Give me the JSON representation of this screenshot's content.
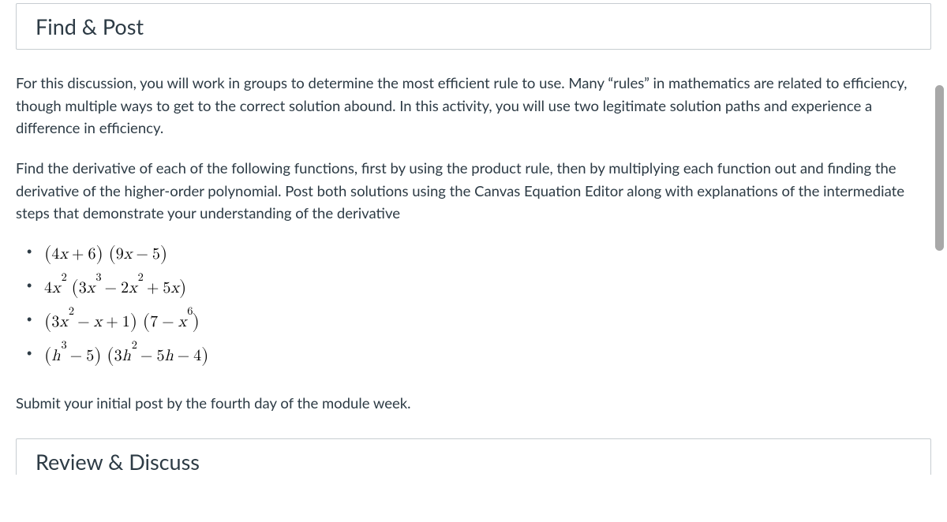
{
  "sections": {
    "find_post": {
      "title": "Find & Post",
      "paragraph1": "For this discussion, you will work in groups to determine the most efficient rule to use. Many “rules” in mathematics are related to efficiency, though multiple ways to get to the correct solution abound. In this activity, you will use two legitimate solution paths and experience a difference in efficiency.",
      "paragraph2": "Find the derivative of each of the following functions, first by using the product rule, then by multiplying each function out and finding the derivative of the higher-order polynomial. Post both solutions using the Canvas Equation Editor along with explanations of the intermediate steps that demonstrate your understanding of the derivative",
      "equations": [
        "(4x + 6)(9x − 5)",
        "4x²(3x³ − 2x² + 5x)",
        "(3x² − x + 1)(7 − x⁶)",
        "(h³ − 5)(3h² − 5h − 4)"
      ],
      "deadline_text": "Submit your initial post by the fourth day of the module week."
    },
    "review_discuss": {
      "title": "Review & Discuss"
    }
  }
}
